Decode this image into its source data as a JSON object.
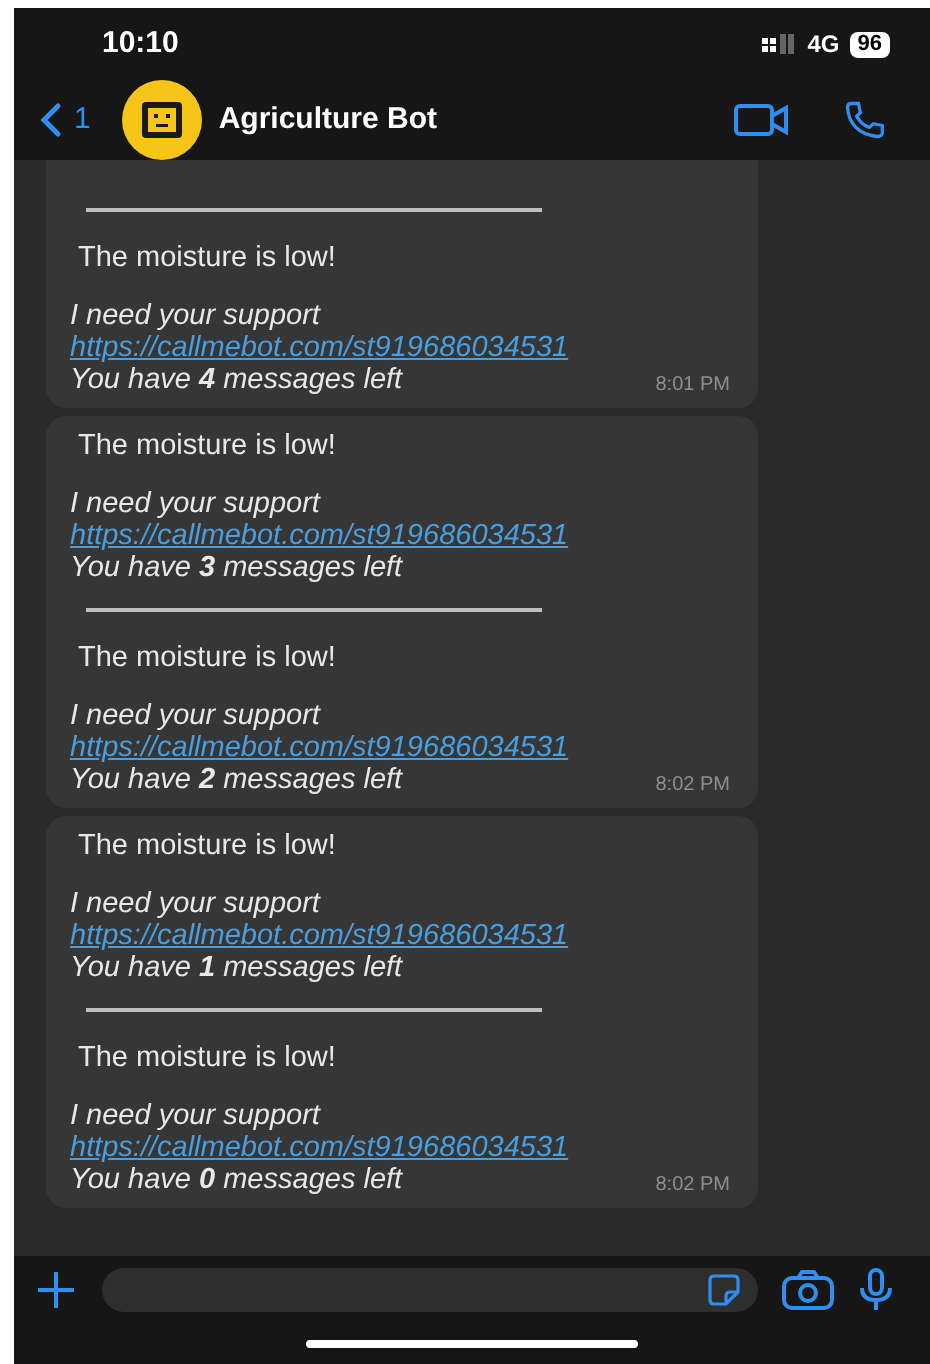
{
  "status_bar": {
    "time": "10:10",
    "network": "4G",
    "battery": "96"
  },
  "header": {
    "back_count": "1",
    "title": "Agriculture Bot"
  },
  "bubbles": [
    {
      "time": "8:01 PM",
      "segments": [
        {
          "kind": "rule"
        },
        {
          "kind": "message",
          "headline": "The moisture is low!",
          "request": "I need your support",
          "link": "https://callmebot.com/st919686034531",
          "remaining": "You have **4** messages left"
        }
      ]
    },
    {
      "time": "8:02 PM",
      "segments": [
        {
          "kind": "message",
          "headline": "The moisture is low!",
          "request": "I need your support",
          "link": "https://callmebot.com/st919686034531",
          "remaining": "You have **3** messages left"
        },
        {
          "kind": "rule"
        },
        {
          "kind": "message",
          "headline": "The moisture is low!",
          "request": "I need your support",
          "link": "https://callmebot.com/st919686034531",
          "remaining": "You have **2** messages left"
        }
      ]
    },
    {
      "time": "8:02 PM",
      "segments": [
        {
          "kind": "message",
          "headline": "The moisture is low!",
          "request": "I need your support",
          "link": "https://callmebot.com/st919686034531",
          "remaining": "You have **1** messages left"
        },
        {
          "kind": "rule"
        },
        {
          "kind": "message",
          "headline": "The moisture is low!",
          "request": "I need your support",
          "link": "https://callmebot.com/st919686034531",
          "remaining": "You have **0** messages left"
        }
      ]
    }
  ]
}
